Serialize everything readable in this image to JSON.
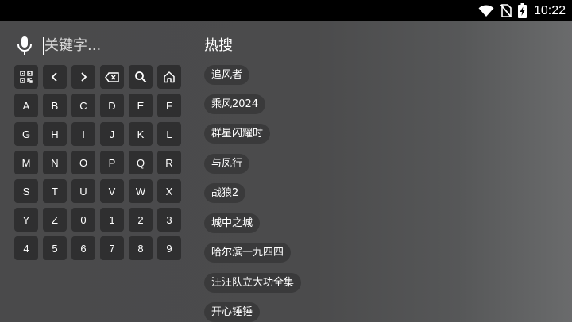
{
  "status_bar": {
    "time": "10:22",
    "icons": [
      "wifi-icon",
      "no-sim-icon",
      "battery-charging-icon"
    ]
  },
  "search": {
    "mic_icon": "microphone-icon",
    "placeholder": "关键字..."
  },
  "keyboard": {
    "function_keys": [
      {
        "icon": "qr-code-icon",
        "name": "qr-code-key"
      },
      {
        "icon": "chevron-left-icon",
        "name": "cursor-left-key"
      },
      {
        "icon": "chevron-right-icon",
        "name": "cursor-right-key"
      },
      {
        "icon": "backspace-icon",
        "name": "backspace-key"
      },
      {
        "icon": "search-icon",
        "name": "search-key"
      },
      {
        "icon": "home-icon",
        "name": "home-key"
      }
    ],
    "keys": [
      "A",
      "B",
      "C",
      "D",
      "E",
      "F",
      "G",
      "H",
      "I",
      "J",
      "K",
      "L",
      "M",
      "N",
      "O",
      "P",
      "Q",
      "R",
      "S",
      "T",
      "U",
      "V",
      "W",
      "X",
      "Y",
      "Z",
      "0",
      "1",
      "2",
      "3",
      "4",
      "5",
      "6",
      "7",
      "8",
      "9"
    ]
  },
  "hot_search": {
    "title": "热搜",
    "items": [
      "追风者",
      "乘风2024",
      "群星闪耀时",
      "与凤行",
      "战狼2",
      "城中之城",
      "哈尔滨一九四四",
      "汪汪队立大功全集",
      "开心锤锤"
    ]
  }
}
